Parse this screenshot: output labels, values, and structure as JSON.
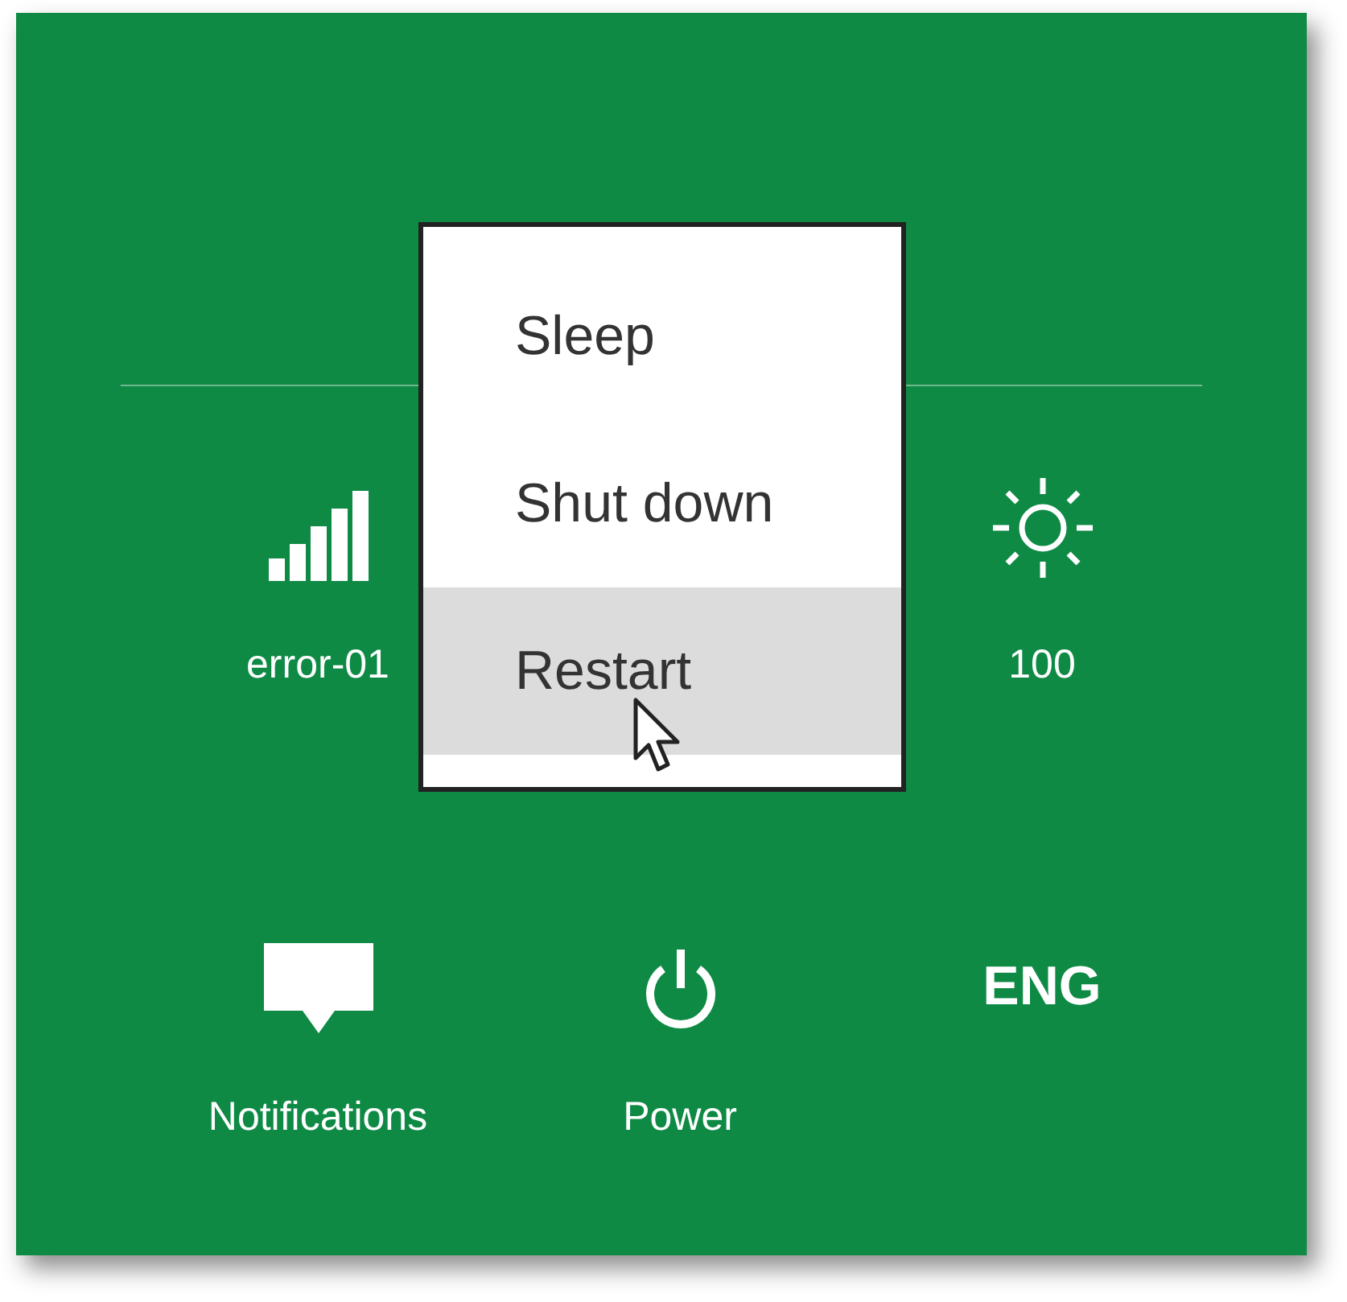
{
  "status_tiles": [
    {
      "kind": "network",
      "label": "error-01"
    },
    {
      "kind": "brightness",
      "label": "100"
    }
  ],
  "bottom_tiles": [
    {
      "kind": "notifications",
      "label": "Notifications"
    },
    {
      "kind": "power",
      "label": "Power"
    },
    {
      "kind": "keyboard",
      "label": "ENG"
    }
  ],
  "power_menu": {
    "items": [
      {
        "label": "Sleep",
        "selected": false
      },
      {
        "label": "Shut down",
        "selected": false
      },
      {
        "label": "Restart",
        "selected": true
      }
    ]
  }
}
